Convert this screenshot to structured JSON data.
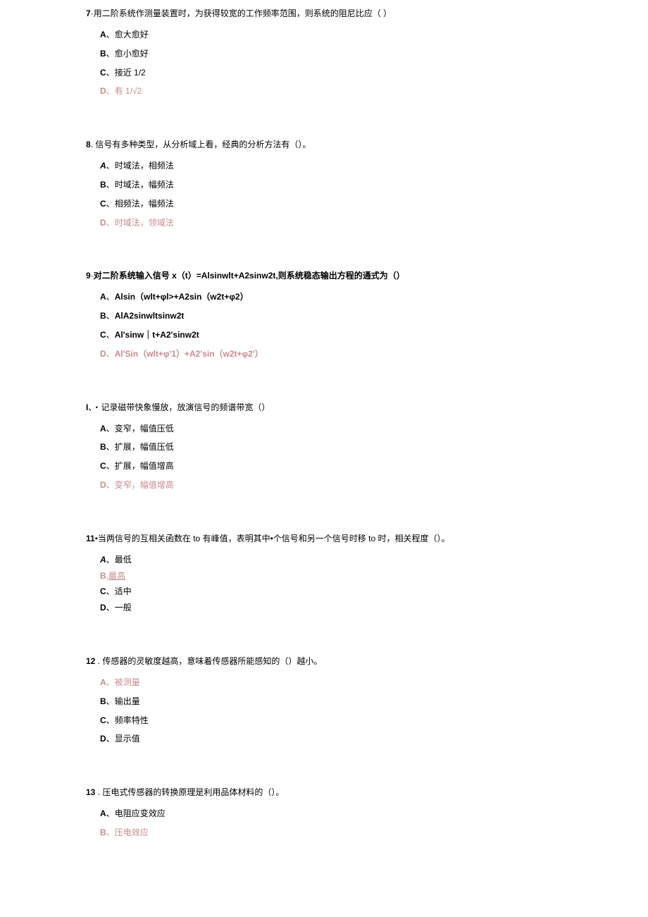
{
  "questions": [
    {
      "num": "7",
      "sep": "·",
      "stem": "用二阶系统作测量装置时，为获得较宽的工作频率范围，则系统的阻尼比应（ ）",
      "opts": [
        {
          "label": "A",
          "sep": "、",
          "text": "愈大愈好",
          "ans": false
        },
        {
          "label": "B",
          "sep": "、",
          "text": "愈小愈好",
          "ans": false
        },
        {
          "label": "C",
          "sep": "、",
          "text": "接近 1/2",
          "ans": false
        },
        {
          "label": "D",
          "sep": "、",
          "text": "有 1/√2",
          "ans": true
        }
      ]
    },
    {
      "num": "8",
      "sep": ". ",
      "stem": "信号有多种类型，从分析域上看，经典的分析方法有（）。",
      "opts": [
        {
          "label": "A",
          "sep": "、",
          "text": "时域法，相频法",
          "ans": false,
          "em": true
        },
        {
          "label": "B",
          "sep": "、",
          "text": "时域法，幅频法",
          "ans": false
        },
        {
          "label": "C",
          "sep": "、",
          "text": "相频法，幅频法",
          "ans": false
        },
        {
          "label": "D",
          "sep": "、",
          "text": "时域法，领域法",
          "ans": true
        }
      ]
    },
    {
      "num": "9",
      "sep": "·",
      "stem": "对二阶系统输入信号 x（t）=Alsinwlt+A2sinw2t,则系统稳态输出方程的通式为（）",
      "stembold": true,
      "opts": [
        {
          "label": "A",
          "sep": "、",
          "text": "Alsin（wlt+φl>+A2sin（w2t+φ2）",
          "ans": false,
          "bold": true
        },
        {
          "label": "B",
          "sep": "、",
          "text": "AlA2sinwltsinw2t",
          "ans": false,
          "bold": true
        },
        {
          "label": "C",
          "sep": "、",
          "text": "Al'sinw｜t+A2'sinw2t",
          "ans": false,
          "bold": true
        },
        {
          "label": "D",
          "sep": "、",
          "text": "Al'Sin（wlt+φ'1）+A2'sin（w2t+φ2'）",
          "ans": true,
          "bold": true
        }
      ]
    },
    {
      "num": "I",
      "sep": "、",
      "stem": "・记录磁带快象慢放，放演信号的频谱带宽（）",
      "opts": [
        {
          "label": "A",
          "sep": "、",
          "text": "变窄，幅值压低",
          "ans": false
        },
        {
          "label": "B",
          "sep": "、",
          "text": "扩展，幅值压低",
          "ans": false
        },
        {
          "label": "C",
          "sep": "、",
          "text": "扩展，幅值增高",
          "ans": false
        },
        {
          "label": "D",
          "sep": "、",
          "text": "变窄，幅值增高",
          "ans": true
        }
      ]
    },
    {
      "num": "11",
      "sep": "•",
      "stem": "当两信号的互相关函数在 to 有峰值，表明其中•个信号和另一个信号时移 to 时，相关程度（）。",
      "opts": [
        {
          "label": "A",
          "sep": "、",
          "text": "最低",
          "ans": false,
          "em": true
        },
        {
          "label": "B",
          "sep": ",",
          "text": "最高",
          "ans": true,
          "underline": true
        },
        {
          "label": "C",
          "sep": "、",
          "text": "适中",
          "ans": false
        },
        {
          "label": "D",
          "sep": "、",
          "text": "一般",
          "ans": false
        }
      ],
      "tight": true
    },
    {
      "num": "12",
      "sep": "    . ",
      "stem": "传感器的灵敏度越高，意味着传感器所能感知的（）越小。",
      "opts": [
        {
          "label": "A",
          "sep": "、",
          "text": "被测量",
          "ans": true
        },
        {
          "label": "B",
          "sep": "、",
          "text": "输出量",
          "ans": false
        },
        {
          "label": "C",
          "sep": "、",
          "text": "频率特性",
          "ans": false
        },
        {
          "label": "D",
          "sep": "、",
          "text": "显示值",
          "ans": false
        }
      ]
    },
    {
      "num": "13",
      "sep": "    . ",
      "stem": "压电式传感器的转换原理是利用品体材料的（）。",
      "opts": [
        {
          "label": "A",
          "sep": "、",
          "text": "电阻应变效应",
          "ans": false
        },
        {
          "label": "B",
          "sep": "、",
          "text": "压电效应",
          "ans": true
        }
      ],
      "last": true
    }
  ]
}
